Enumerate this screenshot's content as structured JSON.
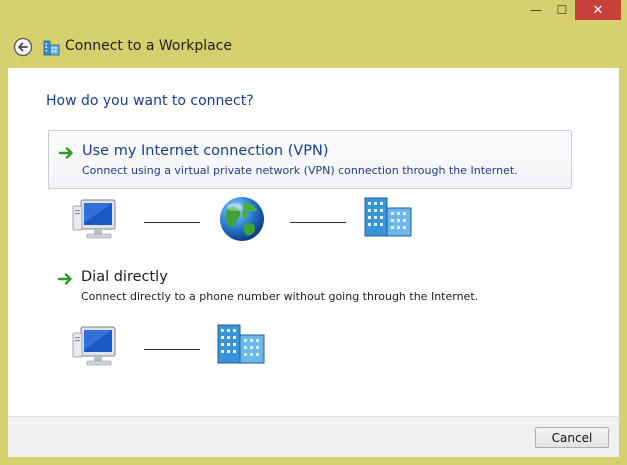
{
  "window": {
    "minimize_glyph": "—",
    "maximize_glyph": "☐",
    "close_glyph": "✕"
  },
  "header": {
    "title": "Connect to a Workplace"
  },
  "main": {
    "question": "How do you want to connect?",
    "options": [
      {
        "title": "Use my Internet connection (VPN)",
        "description": "Connect using a virtual private network (VPN) connection through the Internet."
      },
      {
        "title": "Dial directly",
        "description": "Connect directly to a phone number without going through the Internet."
      }
    ]
  },
  "footer": {
    "cancel_label": "Cancel"
  },
  "colors": {
    "frame": "#d6cf6e",
    "link_blue": "#1a3e8c",
    "close_red": "#c7403a"
  }
}
